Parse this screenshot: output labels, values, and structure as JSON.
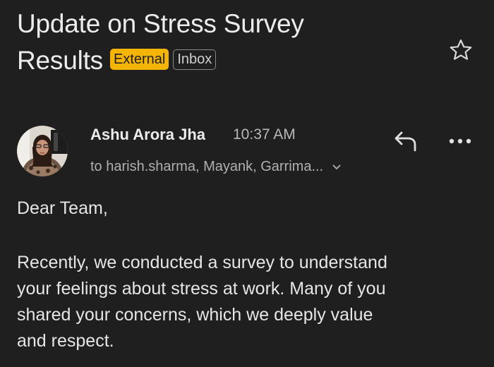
{
  "email": {
    "subject_line1": "Update on Stress Survey",
    "subject_line2": "Results",
    "labels": {
      "external": "External",
      "inbox": "Inbox"
    },
    "sender_name": "Ashu Arora Jha",
    "time": "10:37 AM",
    "recipients": "to harish.sharma, Mayank, Garrima...",
    "greeting": "Dear Team,",
    "body_lines": [
      "Recently, we conducted a survey to understand",
      "your feelings about stress at work. Many of you",
      "shared your concerns, which we deeply value",
      "and respect."
    ]
  },
  "icons": {
    "star": "star-icon",
    "reply": "reply-icon",
    "more": "more-options-icon",
    "expand": "chevron-down-icon"
  },
  "colors": {
    "background": "#1f1f1f",
    "external_badge": "#f5b400",
    "text": "#e6e6e6"
  }
}
